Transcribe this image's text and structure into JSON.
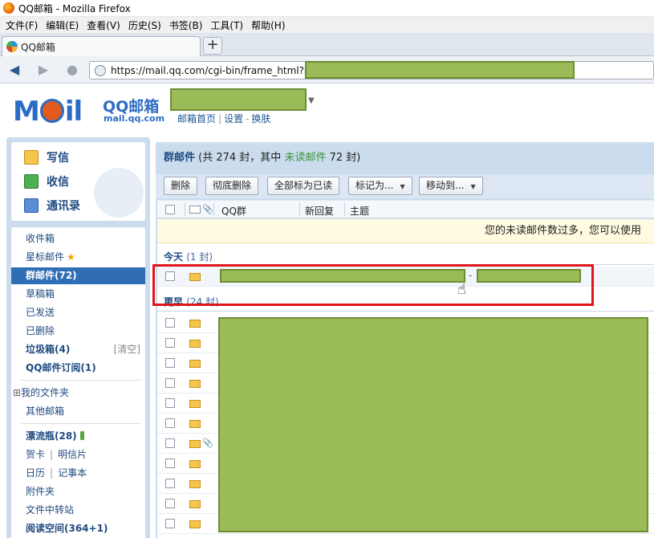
{
  "window": {
    "title": "QQ邮箱 - Mozilla Firefox"
  },
  "menubar": [
    "文件(F)",
    "编辑(E)",
    "查看(V)",
    "历史(S)",
    "书签(B)",
    "工具(T)",
    "帮助(H)"
  ],
  "tab": {
    "label": "QQ邮箱",
    "new_tab": "+"
  },
  "address_bar": {
    "url": "https://mail.qq.com/cgi-bin/frame_html?sid="
  },
  "header": {
    "logo_text": "MOil",
    "brand_cn": "QQ邮箱",
    "brand_en": "mail.qq.com",
    "links": [
      "邮箱首页",
      "设置",
      "换肤"
    ]
  },
  "sidebar": {
    "actions": [
      "写信",
      "收信",
      "通讯录"
    ],
    "folders": {
      "inbox": "收件箱",
      "starred": "星标邮件",
      "group": "群邮件(72)",
      "drafts": "草稿箱",
      "sent": "已发送",
      "deleted": "已删除",
      "spam": "垃圾箱(4)",
      "spam_clear": "[清空]",
      "subscriptions": "QQ邮件订阅(1)",
      "my_folders": "我的文件夹",
      "my_folders_toggle": "⊞",
      "other_mailbox": "其他邮箱",
      "drift_bottle": "漂流瓶(28)",
      "greeting_card": "贺卡",
      "postcard": "明信片",
      "calendar": "日历",
      "notebook": "记事本",
      "attachments": "附件夹",
      "file_transfer": "文件中转站",
      "reading_space": "阅读空间(364+1)"
    }
  },
  "main": {
    "heading": "群邮件",
    "heading_stats_pre": "(共 274 封，其中",
    "heading_unread": "未读邮件",
    "heading_stats_post": "72 封)",
    "toolbar": {
      "delete": "删除",
      "delete_permanent": "彻底删除",
      "mark_all_read": "全部标为已读",
      "mark_as": "标记为...",
      "move_to": "移动到..."
    },
    "columns": {
      "group": "QQ群",
      "new_reply": "新回复",
      "subject": "主题"
    },
    "notice": "您的未读邮件数过多，您可以使用",
    "groups": {
      "today": {
        "label": "今天",
        "count": "(1 封)"
      },
      "earlier": {
        "label": "更早",
        "count": "(24 封)"
      }
    },
    "separator_dash": "-"
  },
  "colors": {
    "accent": "#2f6db5",
    "redaction": "#9bbb59",
    "highlight_box": "#e0151c",
    "unread_green": "#39943a"
  }
}
